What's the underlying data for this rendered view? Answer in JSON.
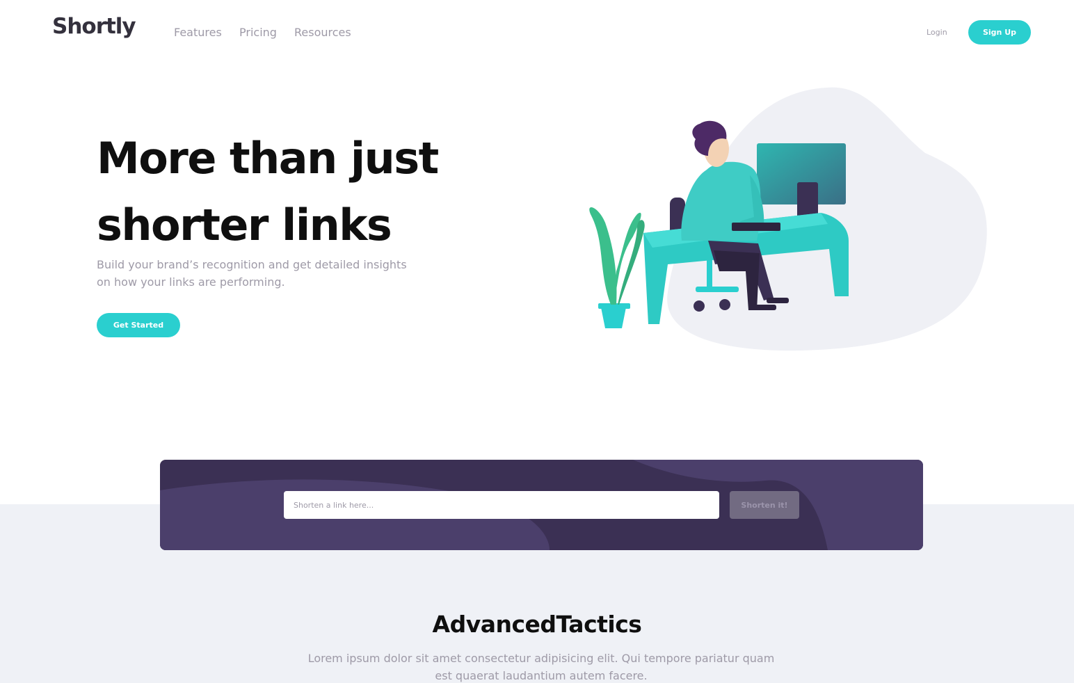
{
  "header": {
    "logo": "Shortly",
    "nav": [
      "Features",
      "Pricing",
      "Resources"
    ],
    "login": "Login",
    "signup": "Sign Up"
  },
  "hero": {
    "title_line1": "More than just",
    "title_line2": "shorter links",
    "subtitle": "Build your brand’s recognition and get detailed insights on how your links are performing.",
    "cta": "Get Started",
    "illustration": "person-working-at-desk-illustration"
  },
  "shorten": {
    "placeholder": "Shorten a link here...",
    "button": "Shorten it!"
  },
  "advanced": {
    "title": "AdvancedTactics",
    "subtitle": "Lorem ipsum dolor sit amet consectetur adipisicing elit. Qui tempore pariatur quam est quaerat laudantium autem facere."
  },
  "colors": {
    "accent": "#2acfcf",
    "dark_violet": "#3b3054",
    "gray": "#9e9aa7",
    "light_bg": "#eff1f6"
  }
}
